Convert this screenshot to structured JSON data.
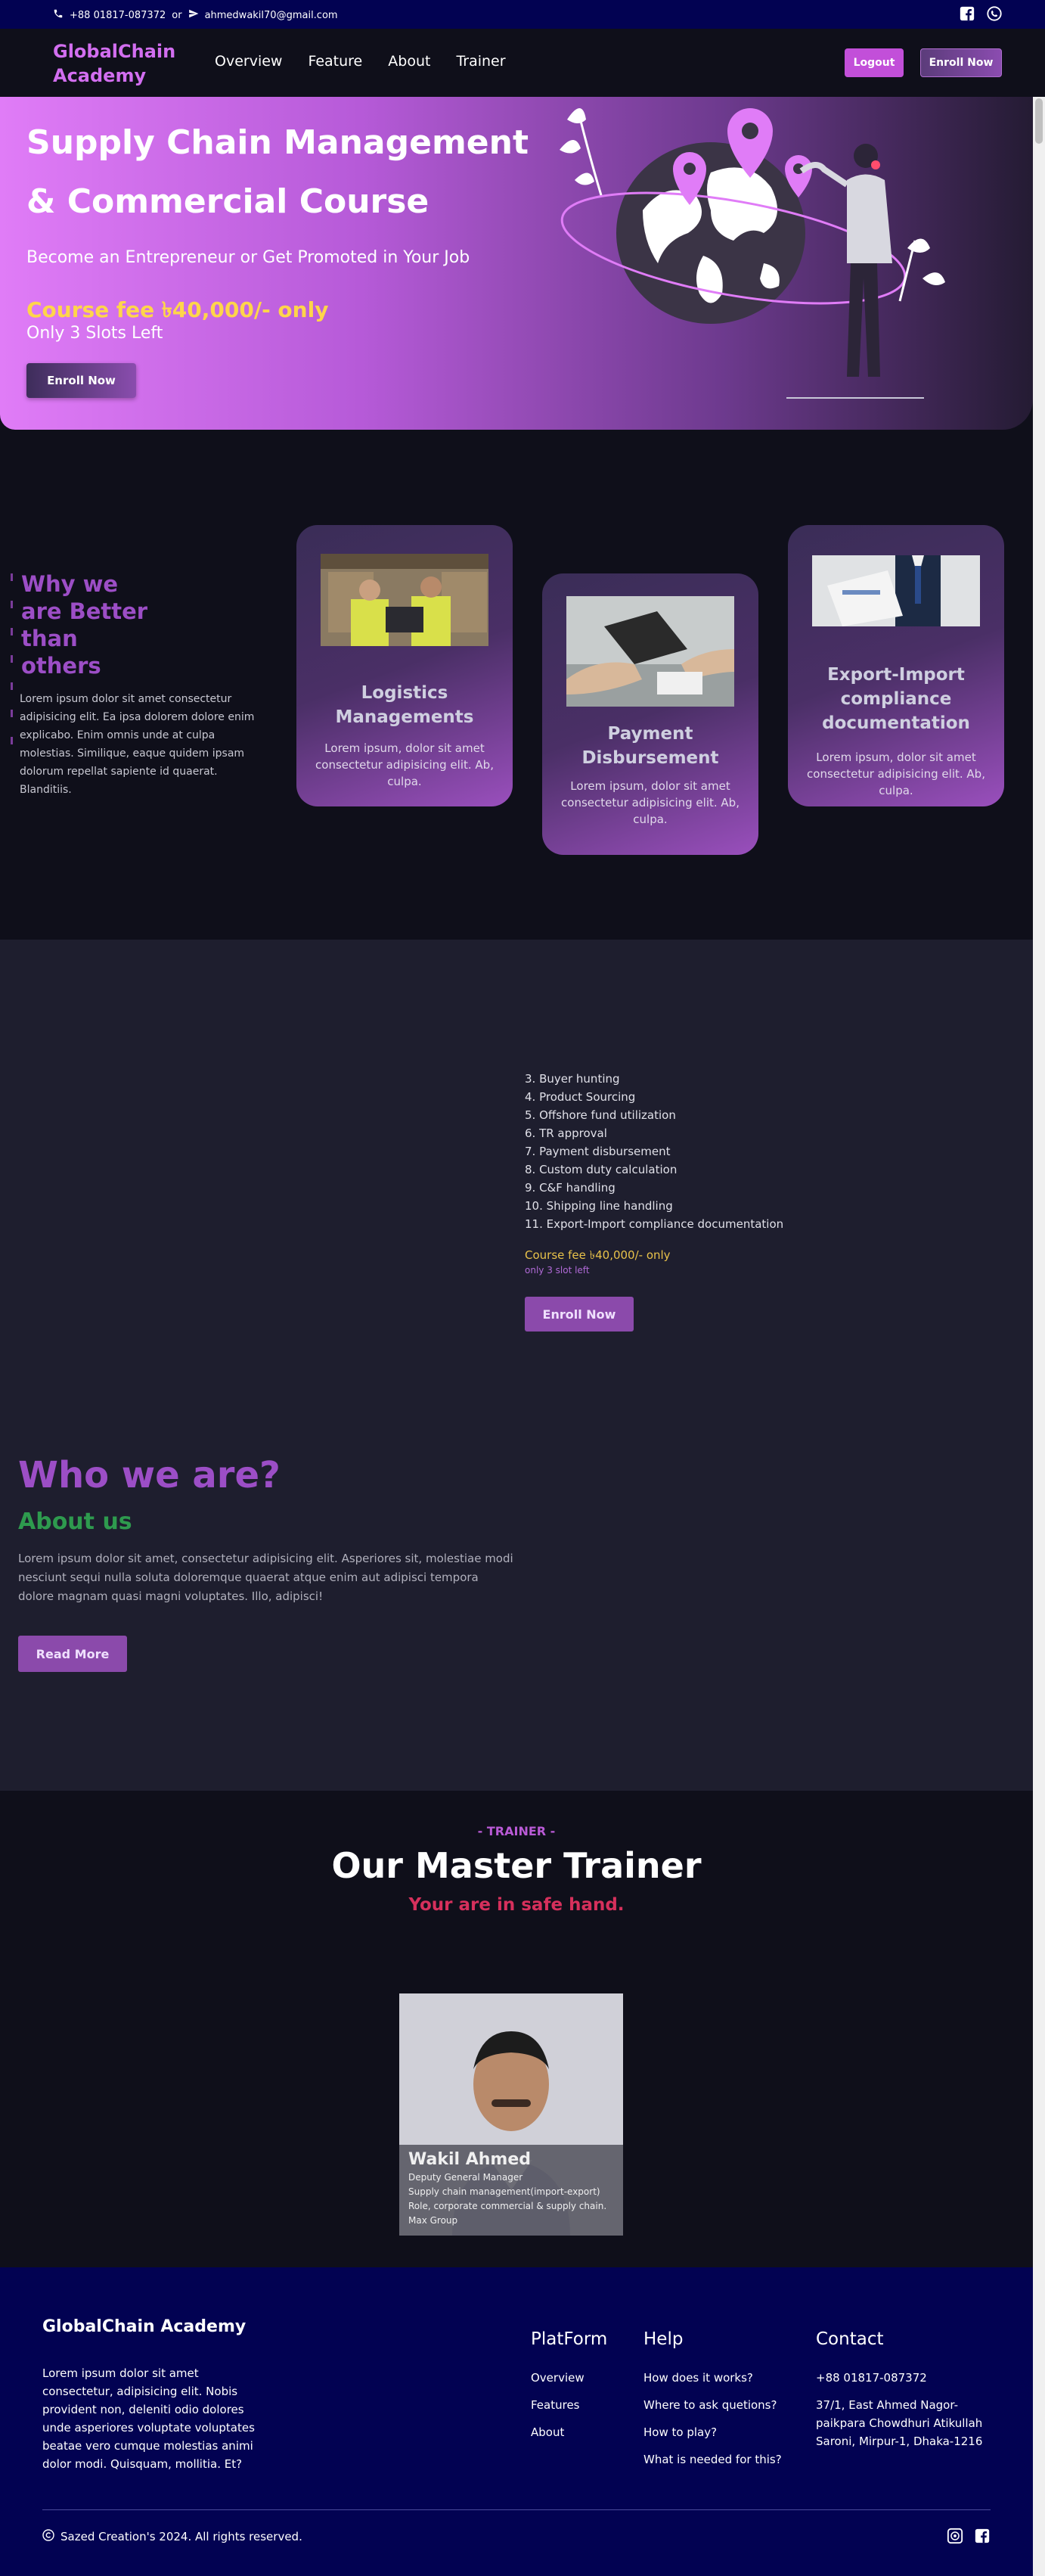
{
  "topbar": {
    "phone": "+88 01817-087372",
    "or": "or",
    "email": "ahmedwakil70@gmail.com"
  },
  "nav": {
    "brand": "GlobalChain Academy",
    "links": [
      "Overview",
      "Feature",
      "About",
      "Trainer"
    ],
    "logout": "Logout",
    "enroll": "Enroll Now"
  },
  "hero": {
    "title": "Supply Chain Management & Commercial Course",
    "subtitle": "Become an Entrepreneur or Get Promoted in Your Job",
    "fee": "Course fee ৳40,000/- only",
    "slots": "Only 3 Slots Left",
    "button": "Enroll Now"
  },
  "why": {
    "title": "Why we are Better than others",
    "text": "Lorem ipsum dolor sit amet consectetur adipisicing elit. Ea ipsa dolorem dolore enim explicabo. Enim omnis unde at culpa molestias. Similique, eaque quidem ipsam dolorum repellat sapiente id quaerat. Blanditiis.",
    "cards": [
      {
        "title": "Logistics Managements",
        "desc": "Lorem ipsum, dolor sit amet consectetur adipisicing elit. Ab, culpa."
      },
      {
        "title": "Payment Disbursement",
        "desc": "Lorem ipsum, dolor sit amet consectetur adipisicing elit. Ab, culpa."
      },
      {
        "title": "Export-Import compliance documentation",
        "desc": "Lorem ipsum, dolor sit amet consectetur adipisicing elit. Ab, culpa."
      }
    ]
  },
  "course": {
    "items": [
      "3. Buyer hunting",
      "4. Product Sourcing",
      "5. Offshore fund utilization",
      "6. TR approval",
      "7. Payment disbursement",
      "8. Custom duty calculation",
      "9. C&F handling",
      "10. Shipping line handling",
      "11. Export-Import compliance documentation"
    ],
    "fee": "Course fee ৳40,000/- only",
    "slots": "only 3 slot left",
    "button": "Enroll Now"
  },
  "about": {
    "heading": "Who we are?",
    "subheading": "About us",
    "text": "Lorem ipsum dolor sit amet, consectetur adipisicing elit. Asperiores sit, molestiae modi nesciunt sequi nulla soluta doloremque quaerat atque enim aut adipisci tempora dolore magnam quasi magni voluptates. Illo, adipisci!",
    "button": "Read More"
  },
  "trainer": {
    "eyebrow": "- TRAINER -",
    "heading": "Our Master Trainer",
    "tagline": "Your are in safe hand.",
    "name": "Wakil Ahmed",
    "role1": "Deputy General Manager",
    "role2": "Supply chain management(import-export)",
    "role3": "Role, corporate commercial & supply chain.",
    "role4": "Max Group"
  },
  "footer": {
    "brand": "GlobalChain Academy",
    "desc": "Lorem ipsum dolor sit amet consectetur, adipisicing elit. Nobis provident non, deleniti odio dolores unde asperiores voluptate voluptates beatae vero cumque molestias animi dolor modi. Quisquam, mollitia. Et?",
    "platform": {
      "title": "PlatForm",
      "items": [
        "Overview",
        "Features",
        "About"
      ]
    },
    "help": {
      "title": "Help",
      "items": [
        "How does it works?",
        "Where to ask quetions?",
        "How to play?",
        "What is needed for this?"
      ]
    },
    "contact": {
      "title": "Contact",
      "phone": "+88 01817-087372",
      "address": "37/1, East Ahmed Nagor-paikpara Chowdhuri Atikullah Saroni, Mirpur-1, Dhaka-1216"
    },
    "copyright": "Sazed Creation's 2024. All rights reserved."
  },
  "colors": {
    "brand": "#d26ef0",
    "accent": "#8b4aab",
    "footer": "#020252",
    "fee": "#ffd54a"
  }
}
